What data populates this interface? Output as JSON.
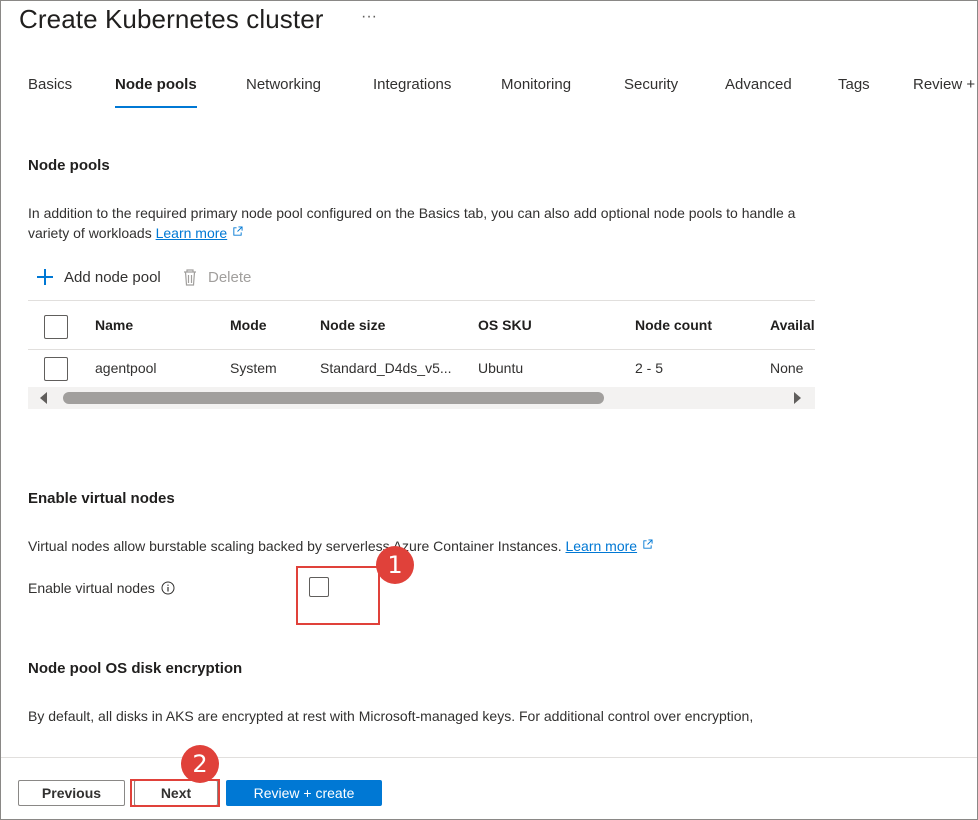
{
  "header": {
    "title": "Create Kubernetes cluster",
    "more": "···"
  },
  "tabs": [
    {
      "label": "Basics"
    },
    {
      "label": "Node pools"
    },
    {
      "label": "Networking"
    },
    {
      "label": "Integrations"
    },
    {
      "label": "Monitoring"
    },
    {
      "label": "Security"
    },
    {
      "label": "Advanced"
    },
    {
      "label": "Tags"
    },
    {
      "label": "Review +"
    }
  ],
  "active_tab": "Node pools",
  "node_pools": {
    "heading": "Node pools",
    "description": "In addition to the required primary node pool configured on the Basics tab, you can also add optional node pools to handle a variety of workloads",
    "learn_more": "Learn more",
    "toolbar": {
      "add_label": "Add node pool",
      "delete_label": "Delete"
    },
    "table": {
      "columns": [
        "Name",
        "Mode",
        "Node size",
        "OS SKU",
        "Node count",
        "Availal"
      ],
      "rows": [
        {
          "name": "agentpool",
          "mode": "System",
          "node_size": "Standard_D4ds_v5...",
          "os_sku": "Ubuntu",
          "node_count": "2 - 5",
          "availability": "None"
        }
      ]
    }
  },
  "virtual_nodes": {
    "heading": "Enable virtual nodes",
    "description_prefix": "Virtual nodes allow burstable scaling backed by serverless Azure Container Instances.",
    "learn_more": "Learn more",
    "field_label": "Enable virtual nodes",
    "checked": false
  },
  "disk_encryption": {
    "heading": "Node pool OS disk encryption",
    "description": "By default, all disks in AKS are encrypted at rest with Microsoft-managed keys. For additional control over encryption,"
  },
  "footer": {
    "previous_label": "Previous",
    "next_label": "Next",
    "review_label": "Review + create"
  },
  "annotations": {
    "step1": "1",
    "step2": "2"
  },
  "colors": {
    "accent": "#0078d4",
    "annotation": "#e0413a"
  }
}
